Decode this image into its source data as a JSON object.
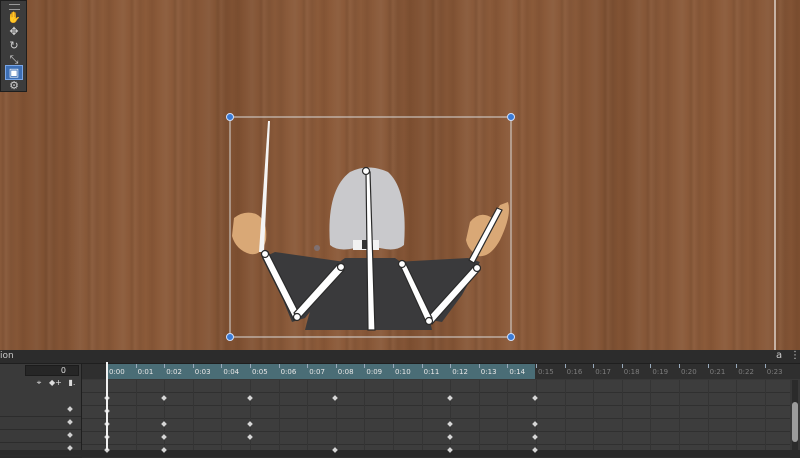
{
  "app": {
    "timeline_title": "ion",
    "frame_value": "0"
  },
  "toolbox": {
    "tools": [
      {
        "name": "hand-tool",
        "glyph": "✋"
      },
      {
        "name": "move-tool",
        "glyph": "✥"
      },
      {
        "name": "rotate-tool",
        "glyph": "↻"
      },
      {
        "name": "scale-tool",
        "glyph": "⤡"
      },
      {
        "name": "rect-tool",
        "glyph": "▣",
        "active": true
      },
      {
        "name": "bone-tool",
        "glyph": "⚙"
      }
    ]
  },
  "timeline": {
    "ticks": [
      "0:00",
      "0:01",
      "0:02",
      "0:03",
      "0:04",
      "0:05",
      "0:06",
      "0:07",
      "0:08",
      "0:09",
      "0:10",
      "0:11",
      "0:12",
      "0:13",
      "0:14",
      "0:15",
      "0:16",
      "0:17",
      "0:18",
      "0:19",
      "0:20",
      "0:21",
      "0:22",
      "0:23"
    ],
    "active_tick_count": 15,
    "key_buttons": [
      "⌖",
      "◆+",
      "▮."
    ],
    "lock_glyph": "a",
    "menu_glyph": "⋮"
  },
  "colors": {
    "wood": "#8a5a3a",
    "selection_handle": "#3a7bd5",
    "ruler_active": "#4a6d76"
  }
}
